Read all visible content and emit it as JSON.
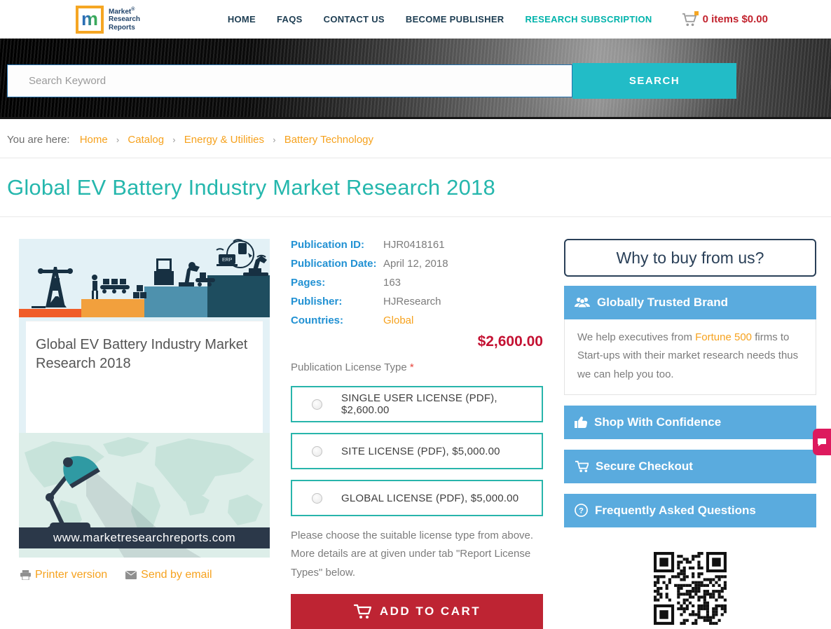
{
  "header": {
    "logo": {
      "letter": "m",
      "line1": "Market",
      "reg": "®",
      "line2": "Research",
      "line3": "Reports"
    },
    "nav": [
      {
        "label": "HOME"
      },
      {
        "label": "FAQS"
      },
      {
        "label": "CONTACT US"
      },
      {
        "label": "BECOME PUBLISHER"
      },
      {
        "label": "RESEARCH SUBSCRIPTION"
      }
    ],
    "cart_text": "0 items $0.00"
  },
  "search": {
    "placeholder": "Search Keyword",
    "button_label": "SEARCH"
  },
  "breadcrumb": {
    "prefix": "You are here:",
    "separator": "›",
    "items": [
      "Home",
      "Catalog",
      "Energy & Utilities",
      "Battery Technology"
    ]
  },
  "page": {
    "title": "Global EV Battery Industry Market Research 2018"
  },
  "product": {
    "image_caption": "Global EV Battery Industry Market Research 2018",
    "image_url_bar": "www.marketresearchreports.com",
    "printer_link": "Printer version",
    "email_link": "Send by email",
    "details": [
      {
        "label": "Publication ID:",
        "value": "HJR0418161"
      },
      {
        "label": "Publication Date:",
        "value": "April 12, 2018"
      },
      {
        "label": "Pages:",
        "value": "163"
      },
      {
        "label": "Publisher:",
        "value": "HJResearch"
      },
      {
        "label": "Countries:",
        "value": "Global"
      }
    ],
    "price": "$2,600.00",
    "license": {
      "label": "Publication License Type",
      "required_mark": "*",
      "options": [
        "SINGLE USER LICENSE (PDF), $2,600.00",
        "SITE LICENSE (PDF), $5,000.00",
        "GLOBAL LICENSE (PDF), $5,000.00"
      ],
      "note": "Please choose the suitable license type from above. More details are at given under tab \"Report License Types\" below."
    },
    "add_to_cart_label": "ADD TO CART"
  },
  "sidebar": {
    "title": "Why to buy from us?",
    "trusted": {
      "label": "Globally Trusted Brand",
      "body_prefix": "We help executives from ",
      "body_link": "Fortune 500",
      "body_suffix": " firms to Start-ups with their market research needs thus we can help you too."
    },
    "panels": [
      {
        "label": "Shop With Confidence"
      },
      {
        "label": "Secure Checkout"
      },
      {
        "label": "Frequently Asked Questions"
      }
    ]
  },
  "colors": {
    "teal": "#22bcc7",
    "title_teal": "#25b7ad",
    "license_border": "#28b5ab",
    "orange": "#f6a21e",
    "red": "#c41233",
    "button_red": "#be2433",
    "label_blue": "#2191d3",
    "sidebar_blue": "#5aabde",
    "navy": "#1d3d52",
    "chat_pink": "#dd1a5e"
  }
}
